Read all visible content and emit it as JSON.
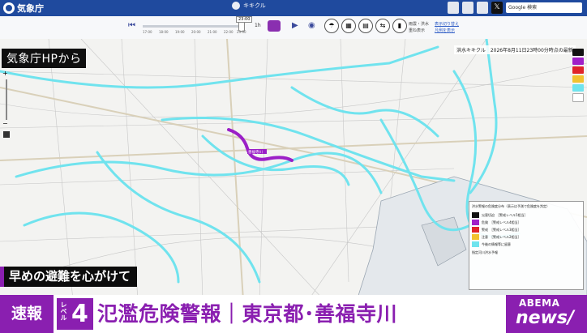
{
  "header": {
    "logo_text": "気象庁",
    "center_title": "キキクル",
    "search_value": "Google 検索"
  },
  "toolbar": {
    "time_label": "23:00",
    "timeline_ticks": [
      "17:00",
      "18:00",
      "19:00",
      "20:00",
      "21:00",
      "22:00",
      "23:00"
    ],
    "offset_label": "1h",
    "right_text_1": "雨雲・洪水",
    "right_text_2": "重ね表示",
    "link_1": "表示切り替え",
    "link_2": "凡例を表示"
  },
  "map": {
    "overlay_source": "気象庁HPから",
    "map_header": "洪水キキクル　2026年8月11日23時00分時点の最新",
    "river_label": "善福寺川",
    "legend_title": "洪水警報の危険度分布（表示は予測で危険度を判定）",
    "legend_items": [
      {
        "label": "災害切迫　［警戒レベル5相当］",
        "color": "#111111"
      },
      {
        "label": "危険　［警戒レベル4相当］",
        "color": "#a020c8"
      },
      {
        "label": "警戒　［警戒レベル3相当］",
        "color": "#e0242a"
      },
      {
        "label": "注意　［警戒レベル2相当］",
        "color": "#f2c230"
      },
      {
        "label": "今後の情報等に留意",
        "color": "#6fe4ee"
      }
    ],
    "legend_note": "指定河川洪水予報",
    "side_colors": [
      "#111111",
      "#a020c8",
      "#e0242a",
      "#f2c230",
      "#6fe4ee",
      "#ffffff"
    ]
  },
  "caption": "早めの避難を心がけて",
  "banner": {
    "breaking": "速報",
    "level_small": "レベル",
    "level_number": "4",
    "headline": "氾濫危険警報｜東京都･善福寺川",
    "abema_top": "ABEMA",
    "abema_bottom": "news/"
  }
}
